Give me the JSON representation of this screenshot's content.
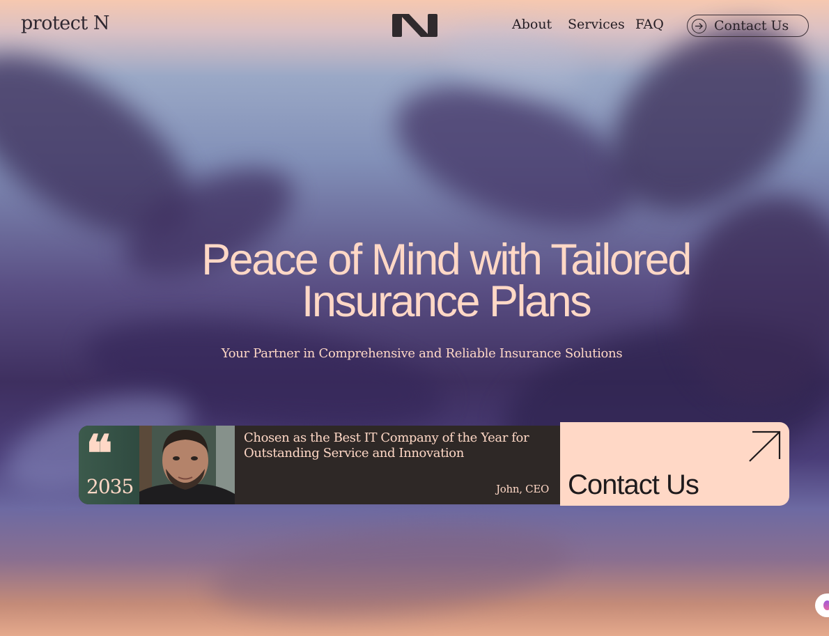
{
  "header": {
    "brand": "protect N",
    "nav": [
      "About",
      "Services",
      "FAQ"
    ],
    "contact_label": "Contact Us"
  },
  "hero": {
    "title_line1": "Peace of Mind with Tailored",
    "title_line2": "Insurance Plans",
    "subtitle": "Your Partner in Comprehensive and Reliable Insurance Solutions"
  },
  "testimonial": {
    "quote_mark": "❝",
    "year": "2035",
    "text": "Chosen as the Best IT Company of the Year for Outstanding Service and Innovation",
    "author": "John, CEO"
  },
  "cta": {
    "label": "Contact Us",
    "icon": "arrow-up-right-icon"
  },
  "colors": {
    "accent": "#ffd8c6",
    "dark": "#2e2826"
  }
}
